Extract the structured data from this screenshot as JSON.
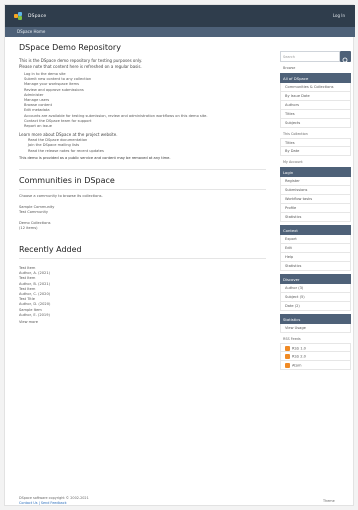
{
  "header": {
    "brand": "DSpace",
    "login": "Log In"
  },
  "breadcrumb": "DSpace Home",
  "page_title": "DSpace Demo Repository",
  "intro": {
    "line1": "This is the DSpace demo repository for testing purposes only.",
    "line2": "Please note that content here is refreshed on a regular basis.",
    "bullets": [
      "Log in to the demo site",
      "Submit new content to any collection",
      "Manage your workspace items",
      "Review and approve submissions",
      "Administer",
      "Manage users",
      "Browse content",
      "Edit metadata"
    ],
    "note": "Accounts are available for testing submission, review and administration workflows on this demo site.",
    "extra": [
      "Contact the DSpace team for support",
      "Report an issue"
    ],
    "help_line": "Learn more about DSpace at the project website.",
    "sub_bullets": [
      "Read the DSpace documentation",
      "Join the DSpace mailing lists",
      "Read the release notes for recent updates"
    ],
    "footnote": "This demo is provided as a public service and content may be removed at any time."
  },
  "communities": {
    "heading": "Communities in DSpace",
    "subtitle": "Choose a community to browse its collections.",
    "items": [
      "Sample Community",
      "Test Community",
      "Demo Collections"
    ],
    "count_label": "(12 items)"
  },
  "recent": {
    "heading": "Recently Added",
    "items": [
      {
        "title": "Test Item",
        "meta": "Author, A. (2021)"
      },
      {
        "title": "Test Item",
        "meta": "Author, B. (2021)"
      },
      {
        "title": "Test Item",
        "meta": "Author, C. (2020)"
      },
      {
        "title": "Test Title",
        "meta": "Author, D. (2020)"
      },
      {
        "title": "Sample Item",
        "meta": "Author, E. (2019)"
      }
    ],
    "more": "View more"
  },
  "sidebar": {
    "search_placeholder": "Search",
    "browse": {
      "heading": "Browse",
      "group1_label": "All of DSpace",
      "group1": [
        "Communities & Collections",
        "By Issue Date",
        "Authors",
        "Titles",
        "Subjects"
      ],
      "group2_label": "This Collection",
      "group2": [
        "Titles",
        "By Date"
      ]
    },
    "myaccount": {
      "heading": "My Account",
      "items": [
        "Login",
        "Register",
        "Submissions",
        "Workflow tasks",
        "Profile",
        "Statistics"
      ]
    },
    "context": {
      "heading": "Context",
      "items": [
        "Export",
        "Edit",
        "Help",
        "Statistics"
      ]
    },
    "discover": {
      "heading": "Discover",
      "items": [
        "Author (3)",
        "Subject (5)",
        "Date (2)"
      ]
    },
    "stats": {
      "heading": "Statistics",
      "items": [
        "View Usage"
      ]
    },
    "rss": {
      "heading": "RSS Feeds",
      "items": [
        "RSS 1.0",
        "RSS 2.0",
        "Atom"
      ]
    }
  },
  "footer": {
    "line1": "DSpace software copyright © 2002-2021",
    "line2": "Contact Us | Send Feedback",
    "right": "Theme"
  }
}
